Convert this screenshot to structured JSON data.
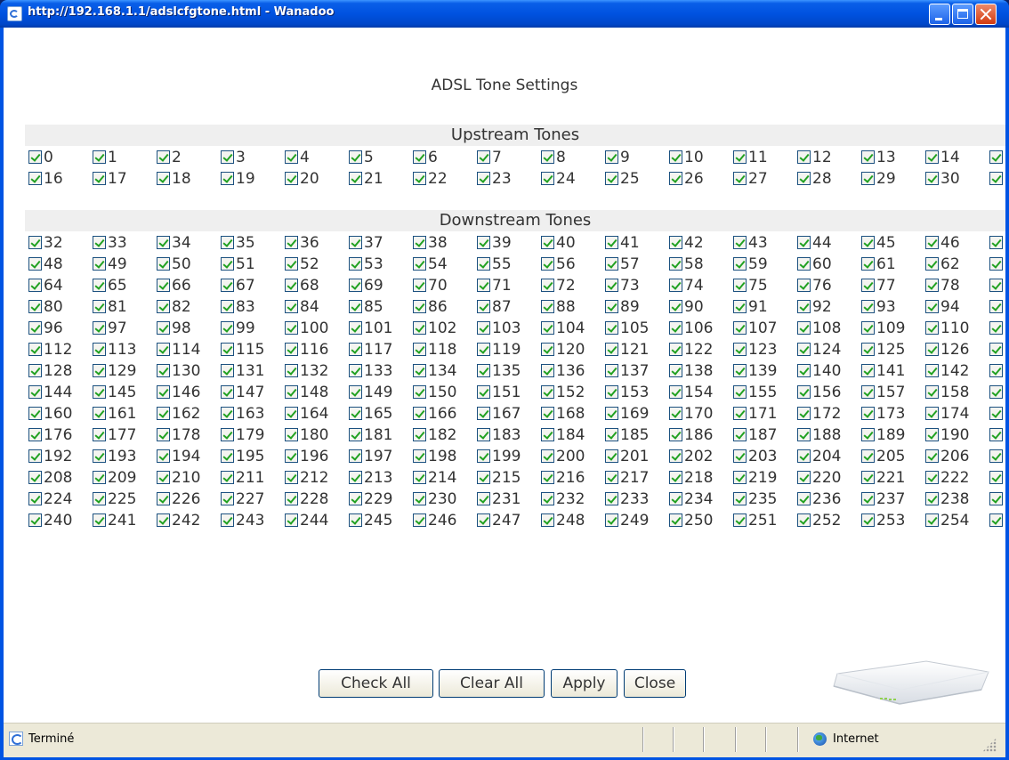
{
  "window": {
    "title": "http://192.168.1.1/adslcfgtone.html - Wanadoo",
    "icon": "ie-page-icon"
  },
  "page": {
    "title": "ADSL Tone Settings"
  },
  "upstream": {
    "header": "Upstream Tones",
    "rows": [
      [
        0,
        1,
        2,
        3,
        4,
        5,
        6,
        7,
        8,
        9,
        10,
        11,
        12,
        13,
        14
      ],
      [
        16,
        17,
        18,
        19,
        20,
        21,
        22,
        23,
        24,
        25,
        26,
        27,
        28,
        29,
        30
      ]
    ]
  },
  "downstream": {
    "header": "Downstream Tones",
    "rows": [
      [
        32,
        33,
        34,
        35,
        36,
        37,
        38,
        39,
        40,
        41,
        42,
        43,
        44,
        45,
        46
      ],
      [
        48,
        49,
        50,
        51,
        52,
        53,
        54,
        55,
        56,
        57,
        58,
        59,
        60,
        61,
        62
      ],
      [
        64,
        65,
        66,
        67,
        68,
        69,
        70,
        71,
        72,
        73,
        74,
        75,
        76,
        77,
        78
      ],
      [
        80,
        81,
        82,
        83,
        84,
        85,
        86,
        87,
        88,
        89,
        90,
        91,
        92,
        93,
        94
      ],
      [
        96,
        97,
        98,
        99,
        100,
        101,
        102,
        103,
        104,
        105,
        106,
        107,
        108,
        109,
        110
      ],
      [
        112,
        113,
        114,
        115,
        116,
        117,
        118,
        119,
        120,
        121,
        122,
        123,
        124,
        125,
        126
      ],
      [
        128,
        129,
        130,
        131,
        132,
        133,
        134,
        135,
        136,
        137,
        138,
        139,
        140,
        141,
        142
      ],
      [
        144,
        145,
        146,
        147,
        148,
        149,
        150,
        151,
        152,
        153,
        154,
        155,
        156,
        157,
        158
      ],
      [
        160,
        161,
        162,
        163,
        164,
        165,
        166,
        167,
        168,
        169,
        170,
        171,
        172,
        173,
        174
      ],
      [
        176,
        177,
        178,
        179,
        180,
        181,
        182,
        183,
        184,
        185,
        186,
        187,
        188,
        189,
        190
      ],
      [
        192,
        193,
        194,
        195,
        196,
        197,
        198,
        199,
        200,
        201,
        202,
        203,
        204,
        205,
        206
      ],
      [
        208,
        209,
        210,
        211,
        212,
        213,
        214,
        215,
        216,
        217,
        218,
        219,
        220,
        221,
        222
      ],
      [
        224,
        225,
        226,
        227,
        228,
        229,
        230,
        231,
        232,
        233,
        234,
        235,
        236,
        237,
        238
      ],
      [
        240,
        241,
        242,
        243,
        244,
        245,
        246,
        247,
        248,
        249,
        250,
        251,
        252,
        253,
        254
      ]
    ]
  },
  "tones_checked": true,
  "buttons": {
    "check_all": "Check All",
    "clear_all": "Clear All",
    "apply": "Apply",
    "close": "Close"
  },
  "status_bar": {
    "text": "Terminé",
    "zone": "Internet"
  },
  "colors": {
    "titlebar": "#0054e3",
    "check": "#21a121",
    "section_bg": "#efefef"
  }
}
